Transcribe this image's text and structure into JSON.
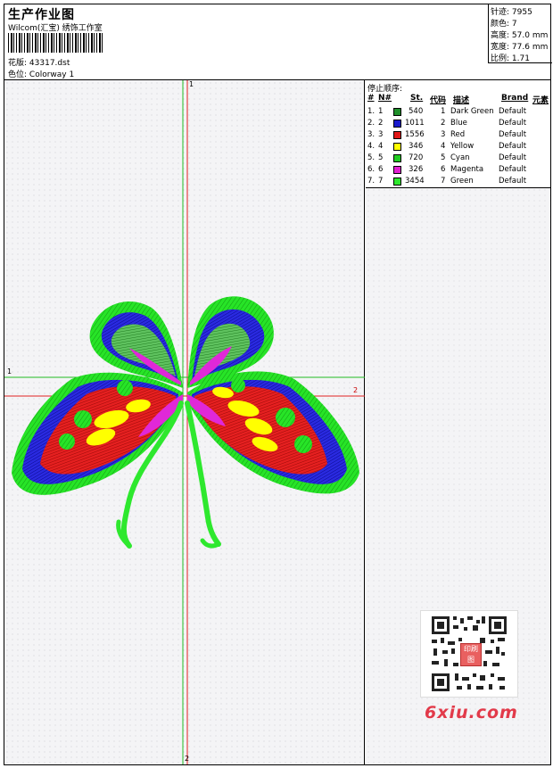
{
  "header": {
    "title": "生产作业图",
    "subtitle": "Wilcom(汇宝) 绣饰工作室",
    "design_label": "花版:",
    "design_value": "43317.dst",
    "colorway_label": "色位:",
    "colorway_value": "Colorway 1"
  },
  "stats": [
    {
      "label": "针迹:",
      "value": "7955"
    },
    {
      "label": "颜色:",
      "value": "7"
    },
    {
      "label": "高度:",
      "value": "57.0 mm"
    },
    {
      "label": "宽度:",
      "value": "77.6 mm"
    },
    {
      "label": "比例:",
      "value": "1.71"
    }
  ],
  "axes": {
    "v_top": "1",
    "v_bottom": "2",
    "h_left": "1",
    "h_right": "2"
  },
  "stop_sequence": {
    "title": "停止顺序:",
    "headers": {
      "idx": "#",
      "no": "N#",
      "st": "St.",
      "code": "代码",
      "desc": "描述",
      "brand": "Brand",
      "elem": "元素"
    },
    "rows": [
      {
        "idx": "1.",
        "no": "1",
        "color": "#1f8f2a",
        "st": "540",
        "code": "1",
        "desc": "Dark Green",
        "brand": "Default"
      },
      {
        "idx": "2.",
        "no": "2",
        "color": "#1a1acc",
        "st": "1011",
        "code": "2",
        "desc": "Blue",
        "brand": "Default"
      },
      {
        "idx": "3.",
        "no": "3",
        "color": "#e01818",
        "st": "1556",
        "code": "3",
        "desc": "Red",
        "brand": "Default"
      },
      {
        "idx": "4.",
        "no": "4",
        "color": "#ffff00",
        "st": "346",
        "code": "4",
        "desc": "Yellow",
        "brand": "Default"
      },
      {
        "idx": "5.",
        "no": "5",
        "color": "#22cc22",
        "st": "720",
        "code": "5",
        "desc": "Cyan",
        "brand": "Default"
      },
      {
        "idx": "6.",
        "no": "6",
        "color": "#e020d0",
        "st": "326",
        "code": "6",
        "desc": "Magenta",
        "brand": "Default"
      },
      {
        "idx": "7.",
        "no": "7",
        "color": "#2ee82e",
        "st": "3454",
        "code": "7",
        "desc": "Green",
        "brand": "Default"
      }
    ]
  },
  "watermark": "6xiu.com",
  "qr_stamp": "印刷图"
}
